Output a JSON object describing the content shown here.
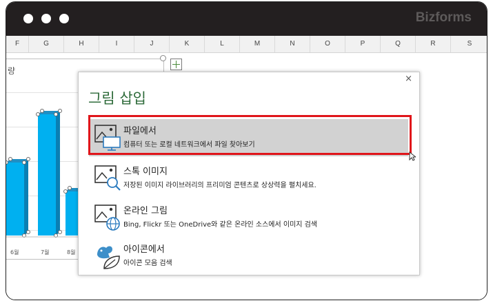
{
  "window": {
    "brand": "Bizforms"
  },
  "columns": [
    "F",
    "G",
    "H",
    "I",
    "J",
    "K",
    "L",
    "M",
    "N",
    "O",
    "P",
    "Q",
    "R",
    "S"
  ],
  "chart": {
    "title_fragment": "량",
    "x_labels": [
      "6월",
      "7월",
      "8월"
    ]
  },
  "dialog": {
    "title": "그림 삽입",
    "close_label": "×",
    "options": [
      {
        "title": "파일에서",
        "desc": "컴퓨터 또는 로컬 네트워크에서 파일 찾아보기",
        "icon": "picture-computer-icon"
      },
      {
        "title": "스톡 이미지",
        "desc": "저장된 이미지 라이브러리의 프리미엄 콘텐츠로 상상력을 펼치세요.",
        "icon": "picture-search-icon"
      },
      {
        "title": "온라인 그림",
        "desc": "Bing, Flickr 또는 OneDrive와 같은 온라인 소스에서 이미지 검색",
        "icon": "picture-globe-icon"
      },
      {
        "title": "아이콘에서",
        "desc": "아이콘 모음 검색",
        "icon": "bird-leaf-icon"
      }
    ]
  },
  "colors": {
    "accent_green": "#2e6b3a",
    "bar_blue": "#00b0f0",
    "highlight_red": "#e0151a",
    "selected_gray": "#d2d2d2"
  }
}
